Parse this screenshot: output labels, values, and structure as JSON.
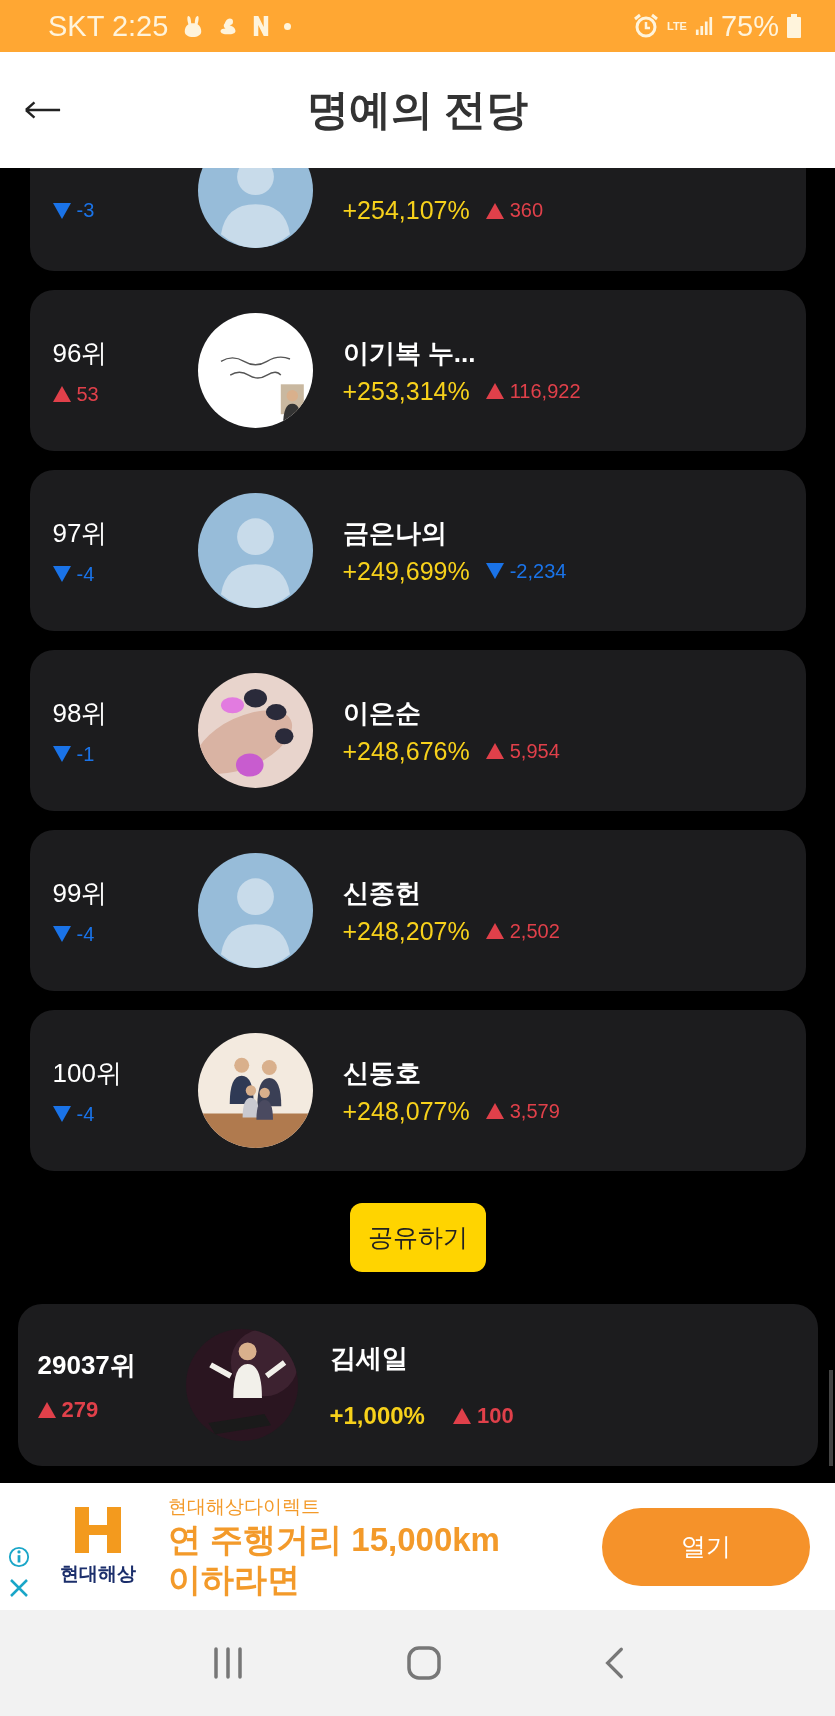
{
  "status_bar": {
    "carrier_time": "SKT 2:25",
    "network": "LTE",
    "battery": "75%"
  },
  "header": {
    "title": "명예의 전당"
  },
  "rankings": [
    {
      "percent": "+254,107%",
      "rank_change": {
        "rising": false,
        "value": "-3"
      },
      "score_change": {
        "rising": true,
        "value": "360"
      },
      "avatar": {
        "kind": "default"
      }
    },
    {
      "rank": "96위",
      "name": "이기복 누...",
      "percent": "+253,314%",
      "rank_change": {
        "rising": true,
        "value": "53"
      },
      "score_change": {
        "rising": true,
        "value": "116,922"
      }
    },
    {
      "rank": "97위",
      "name": "금은나의",
      "percent": "+249,699%",
      "rank_change": {
        "rising": false,
        "value": "-4"
      },
      "score_change": {
        "rising": false,
        "value": "-2,234"
      },
      "avatar": {
        "kind": "default"
      }
    },
    {
      "rank": "98위",
      "name": "이은순",
      "percent": "+248,676%",
      "rank_change": {
        "rising": false,
        "value": "-1"
      },
      "score_change": {
        "rising": true,
        "value": "5,954"
      }
    },
    {
      "rank": "99위",
      "name": "신종헌",
      "percent": "+248,207%",
      "rank_change": {
        "rising": false,
        "value": "-4"
      },
      "score_change": {
        "rising": true,
        "value": "2,502"
      },
      "avatar": {
        "kind": "default"
      }
    },
    {
      "rank": "100위",
      "name": "신동호",
      "percent": "+248,077%",
      "rank_change": {
        "rising": false,
        "value": "-4"
      },
      "score_change": {
        "rising": true,
        "value": "3,579"
      }
    }
  ],
  "share_button": "공유하기",
  "my_rank": {
    "rank": "29037위",
    "name": "김세일",
    "percent": "+1,000%",
    "rank_change": {
      "rising": true,
      "value": "279"
    },
    "score_change": {
      "rising": true,
      "value": "100"
    }
  },
  "ad": {
    "brand": "현대해상",
    "sponsor": "현대해상다이렉트",
    "headline": "연 주행거리 15,000km 이하라면",
    "button": "열기"
  }
}
